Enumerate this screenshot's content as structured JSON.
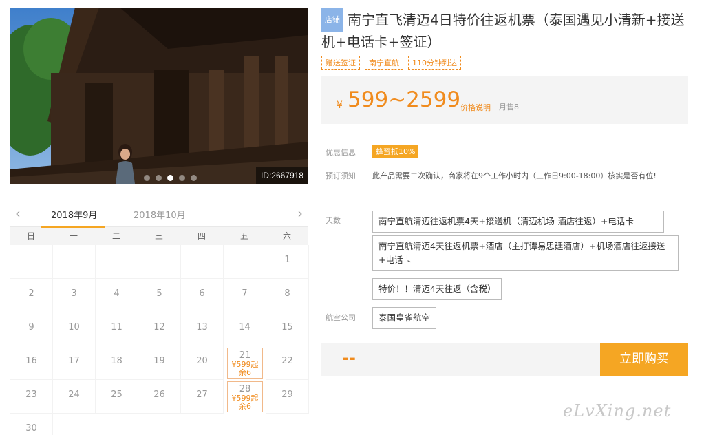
{
  "photo": {
    "id_label": "ID:2667918",
    "dots": 5,
    "active_dot": 2
  },
  "calendar": {
    "prev_icon": "chevron-left-icon",
    "next_icon": "chevron-right-icon",
    "months": [
      "2018年9月",
      "2018年10月"
    ],
    "active_month": 0,
    "weekdays": [
      "日",
      "一",
      "二",
      "三",
      "四",
      "五",
      "六"
    ],
    "cells": [
      {
        "day": ""
      },
      {
        "day": ""
      },
      {
        "day": ""
      },
      {
        "day": ""
      },
      {
        "day": ""
      },
      {
        "day": ""
      },
      {
        "day": "1"
      },
      {
        "day": "2"
      },
      {
        "day": "3"
      },
      {
        "day": "4"
      },
      {
        "day": "5"
      },
      {
        "day": "6"
      },
      {
        "day": "7"
      },
      {
        "day": "8"
      },
      {
        "day": "9"
      },
      {
        "day": "10"
      },
      {
        "day": "11"
      },
      {
        "day": "12"
      },
      {
        "day": "13"
      },
      {
        "day": "14"
      },
      {
        "day": "15"
      },
      {
        "day": "16"
      },
      {
        "day": "17"
      },
      {
        "day": "18"
      },
      {
        "day": "19"
      },
      {
        "day": "20"
      },
      {
        "day": "21",
        "price": "¥599起",
        "stock": "余6"
      },
      {
        "day": "22"
      },
      {
        "day": "23"
      },
      {
        "day": "24"
      },
      {
        "day": "25"
      },
      {
        "day": "26"
      },
      {
        "day": "27"
      },
      {
        "day": "28",
        "price": "¥599起",
        "stock": "余6"
      },
      {
        "day": "29"
      },
      {
        "day": "30"
      }
    ]
  },
  "product": {
    "shop_tag": "店铺",
    "title": "南宁直飞清迈4日特价往返机票（泰国遇见小清新+接送机+电话卡+签证）",
    "tags": [
      "赠送签证",
      "南宁直航",
      "110分钟到达"
    ]
  },
  "price": {
    "currency": "¥",
    "range": "599~2599",
    "note": "价格说明",
    "sales": "月售8"
  },
  "info": {
    "promo_label": "优惠信息",
    "promo_badge": "蜂蜜抵10%",
    "notice_label": "预订须知",
    "notice_text": "此产品需要二次确认，商家将在9个工作小时内（工作日9:00-18:00）核实是否有位!",
    "days_label": "天数",
    "options": [
      "南宁直航清迈往返机票4天+接送机（清迈机场-酒店往返）+电话卡",
      "南宁直航清迈4天往返机票+酒店（主打谭易思廷酒店）+机场酒店往返接送+电话卡",
      "特价！！清迈4天往返（含税）"
    ],
    "airline_label": "航空公司",
    "airline": "泰国皇雀航空"
  },
  "buy": {
    "total": "--",
    "button": "立即购买"
  },
  "watermark": "eLvXing.net",
  "colors": {
    "accent": "#f5a623",
    "price": "#f08b1d",
    "shop_tag": "#8bb4e8"
  }
}
